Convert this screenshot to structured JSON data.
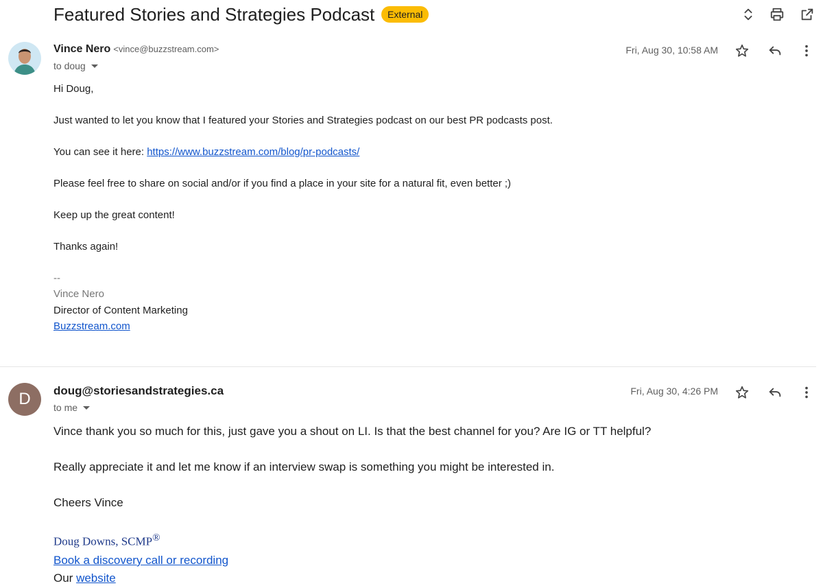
{
  "thread": {
    "subject": "Featured Stories and Strategies Podcast",
    "badge": "External"
  },
  "messages": [
    {
      "sender_name": "Vince Nero",
      "sender_email": "<vince@buzzstream.com>",
      "to": "to doug",
      "date": "Fri, Aug 30, 10:58 AM",
      "greeting": "Hi Doug,",
      "line1": "Just wanted to let you know that I featured your Stories and Strategies podcast on our best PR podcasts post.",
      "see_prefix": "You can see it here: ",
      "link": "https://www.buzzstream.com/blog/pr-podcasts/",
      "line3": "Please feel free to share on social and/or if you find a place in your site for a natural fit, even better ;)",
      "line4": "Keep up the great content!",
      "line5": "Thanks again!",
      "sig_dashes": "--",
      "sig_name": "Vince Nero",
      "sig_title": "Director of Content Marketing",
      "sig_link": "Buzzstream.com"
    },
    {
      "avatar_letter": "D",
      "sender_name": "doug@storiesandstrategies.ca",
      "to": "to me",
      "date": "Fri, Aug 30, 4:26 PM",
      "line1": "Vince thank you so much for this, just gave you a shout on LI. Is that the best channel for you? Are IG or TT helpful?",
      "line2": "Really appreciate it and let me know if an interview swap is something you might be interested in.",
      "line3": "Cheers Vince",
      "sig_name": "Doug Downs, SCMP",
      "sig_reg": "®",
      "sig_link": "Book a discovery call or recording",
      "sig_our": "Our ",
      "sig_website": "website"
    }
  ],
  "icons": {
    "expand": "unfold-icon",
    "print": "print-icon",
    "open_new": "open-in-new-icon",
    "star": "star-icon",
    "reply": "reply-icon",
    "more": "more-vert-icon"
  },
  "colors": {
    "badge": "#fbbc04",
    "link": "#1155cc",
    "avatar_d": "#8d6e63"
  }
}
